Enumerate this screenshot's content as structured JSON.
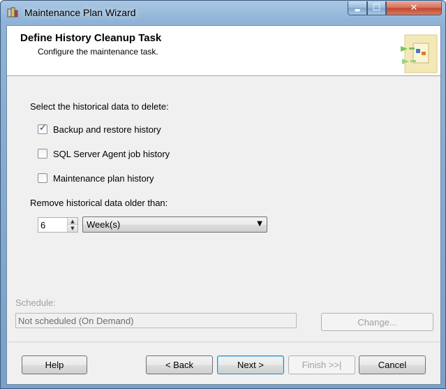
{
  "window": {
    "title": "Maintenance Plan Wizard"
  },
  "titlebar_buttons": {
    "minimize": "▬",
    "maximize": "☐",
    "close": "✕"
  },
  "header": {
    "title": "Define History Cleanup Task",
    "subtitle": "Configure the maintenance task."
  },
  "form": {
    "select_label": "Select the historical data to delete:",
    "options": [
      {
        "label": "Backup and restore history",
        "checked": true
      },
      {
        "label": "SQL Server Agent job history",
        "checked": false
      },
      {
        "label": "Maintenance plan history",
        "checked": false
      }
    ],
    "remove_label": "Remove historical data older than:",
    "age_value": "6",
    "unit_value": "Week(s)"
  },
  "schedule": {
    "label": "Schedule:",
    "value": "Not scheduled (On Demand)",
    "change_button": "Change..."
  },
  "buttons": {
    "help": "Help",
    "back": "< Back",
    "next": "Next >",
    "finish": "Finish >>|",
    "cancel": "Cancel"
  }
}
